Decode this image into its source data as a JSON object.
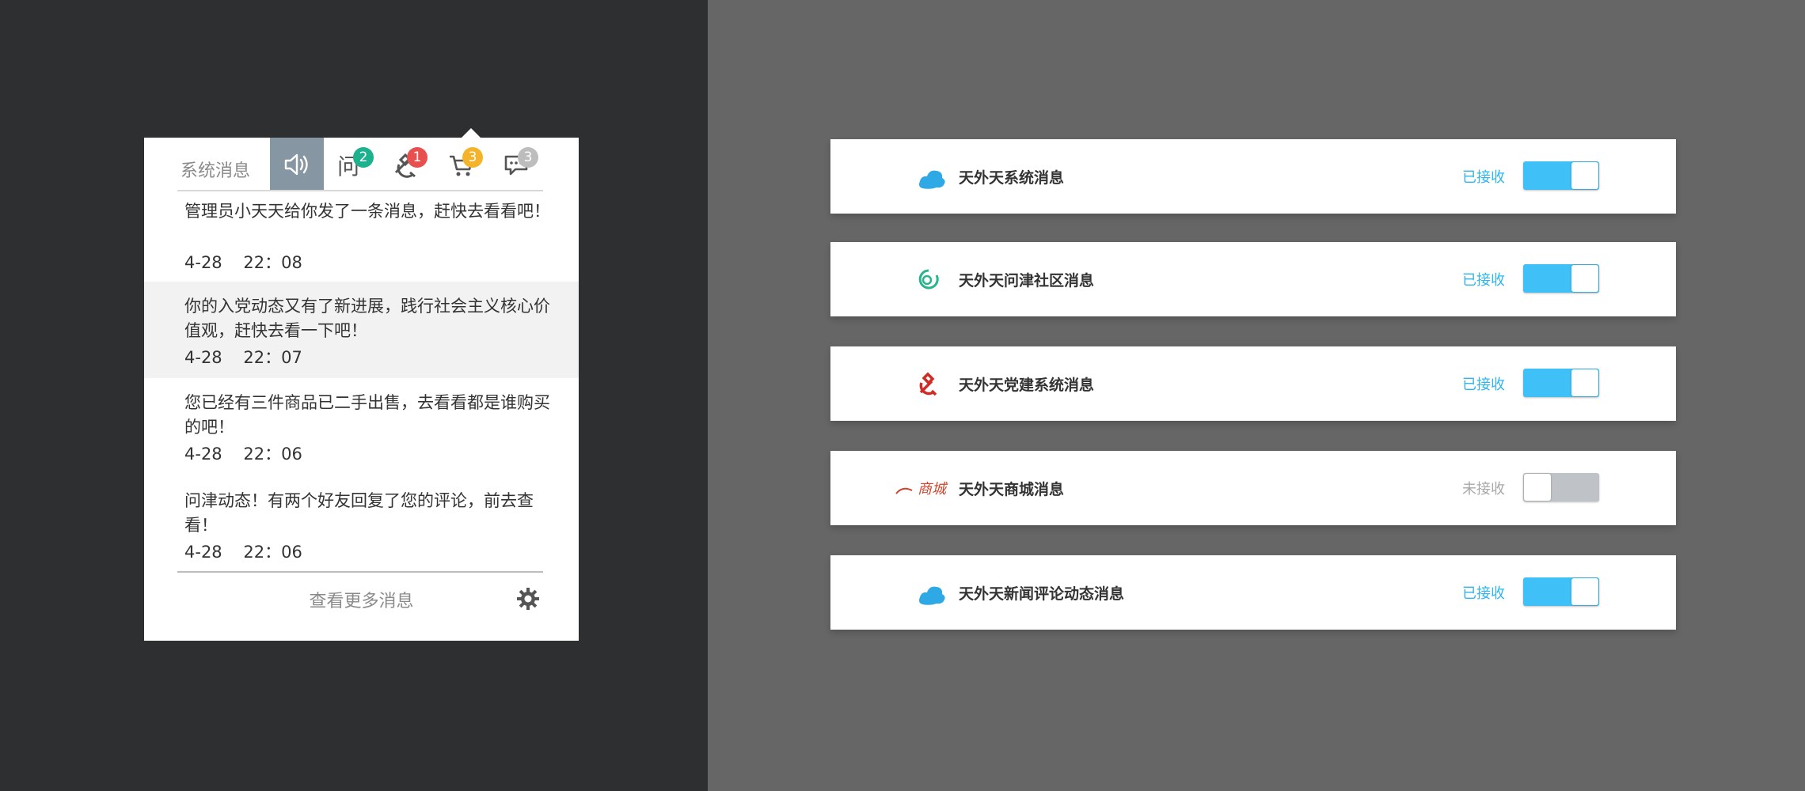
{
  "popover": {
    "tab_label": "系统消息",
    "tabs": [
      {
        "icon": "speaker-icon",
        "badge": ""
      },
      {
        "icon": "question-icon",
        "badge": "2",
        "badge_color": "#1db18d"
      },
      {
        "icon": "party-emblem-icon",
        "badge": "1",
        "badge_color": "#e8504f"
      },
      {
        "icon": "cart-icon",
        "badge": "3",
        "badge_color": "#f3b42c"
      },
      {
        "icon": "comment-icon",
        "badge": "3",
        "badge_color": "#bdbdbd"
      }
    ],
    "messages": [
      {
        "text": "管理员小天天给你发了一条消息，赶快去看看吧！",
        "time": "4-28    22：08"
      },
      {
        "text": "你的入党动态又有了新进展，践行社会主义核心价值观，赶快去看一下吧！",
        "time": "4-28    22：07"
      },
      {
        "text": "您已经有三件商品已二手出售，去看看都是谁购买的吧！",
        "time": "4-28    22：06"
      },
      {
        "text": "问津动态！有两个好友回复了您的评论，前去查看！",
        "time": "4-28    22：06"
      }
    ],
    "more_label": "查看更多消息"
  },
  "cards": [
    {
      "title": "天外天系统消息",
      "status": "已接收",
      "on": true,
      "icon": "cloud-icon"
    },
    {
      "title": "天外天问津社区消息",
      "status": "已接收",
      "on": true,
      "icon": "ring-icon"
    },
    {
      "title": "天外天党建系统消息",
      "status": "已接收",
      "on": true,
      "icon": "party-emblem-icon"
    },
    {
      "title": "天外天商城消息",
      "status": "未接收",
      "on": false,
      "icon": "mall-logo",
      "logo_text": "商城"
    },
    {
      "title": "天外天新闻评论动态消息",
      "status": "已接收",
      "on": true,
      "icon": "cloud-icon"
    }
  ],
  "colors": {
    "accent": "#3fc0f7",
    "status_on": "#2fb5ee",
    "status_off": "#a8a8a8"
  }
}
